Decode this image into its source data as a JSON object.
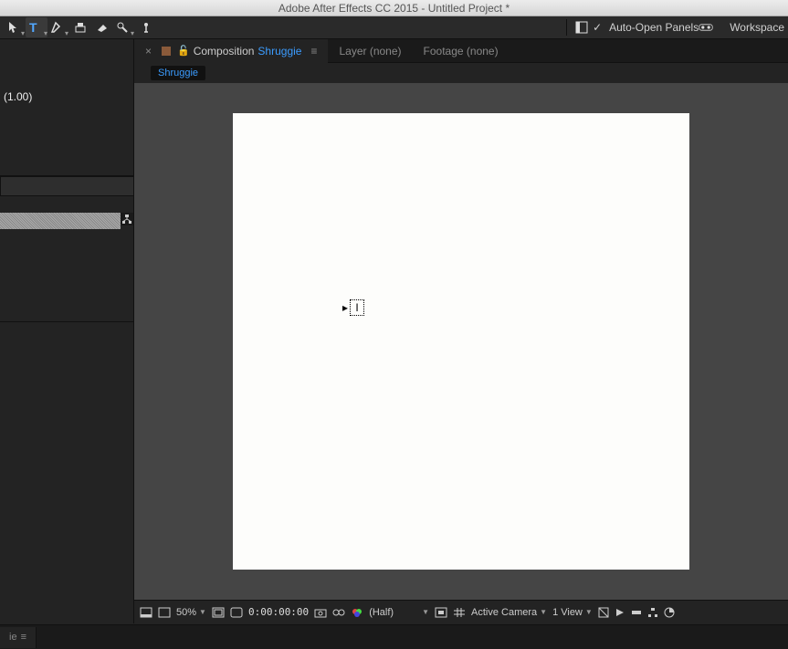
{
  "titlebar": "Adobe After Effects CC 2015 - Untitled Project *",
  "toolbar": {
    "auto_open": "Auto-Open Panels",
    "workspace": "Workspace"
  },
  "left": {
    "project_value": "(1.00)"
  },
  "viewer": {
    "tab_comp_label": "Composition",
    "tab_comp_name": "Shruggie",
    "tab_layer": "Layer (none)",
    "tab_footage": "Footage (none)",
    "subtab": "Shruggie"
  },
  "footer": {
    "zoom": "50%",
    "timecode": "0:00:00:00",
    "resolution": "(Half)",
    "camera": "Active Camera",
    "views": "1 View"
  },
  "bottom": {
    "tab": "ie"
  }
}
